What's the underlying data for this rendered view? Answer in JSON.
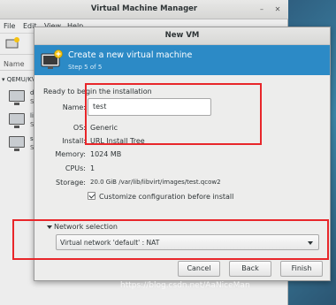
{
  "vmm": {
    "title": "Virtual Machine Manager",
    "menu": [
      "File",
      "Edit",
      "View",
      "Help"
    ],
    "column_header": "Name",
    "connection": "QEMU/KVM",
    "vms": [
      {
        "name": "de",
        "state": "Sh"
      },
      {
        "name": "lib",
        "state": "Sh"
      },
      {
        "name": "se",
        "state": "Sh"
      }
    ]
  },
  "dialog": {
    "title": "New VM",
    "banner_title": "Create a new virtual machine",
    "banner_step": "Step 5 of 5",
    "ready_text": "Ready to begin the installation",
    "fields": {
      "name_label": "Name:",
      "name_value": "test",
      "os_label": "OS:",
      "os_value": "Generic",
      "install_label": "Install:",
      "install_value": "URL Install Tree",
      "memory_label": "Memory:",
      "memory_value": "1024 MB",
      "cpus_label": "CPUs:",
      "cpus_value": "1",
      "storage_label": "Storage:",
      "storage_value": "20.0 GiB /var/lib/libvirt/images/test.qcow2"
    },
    "customize_label": "Customize configuration before install",
    "customize_checked": true,
    "network": {
      "header": "Network selection",
      "selected": "Virtual network 'default' : NAT"
    },
    "buttons": {
      "cancel": "Cancel",
      "back": "Back",
      "finish": "Finish"
    }
  },
  "colors": {
    "banner": "#2c8ac6",
    "annotation": "#e8262a"
  },
  "watermark": "https://blog.csdn.net/AaNiceMan"
}
